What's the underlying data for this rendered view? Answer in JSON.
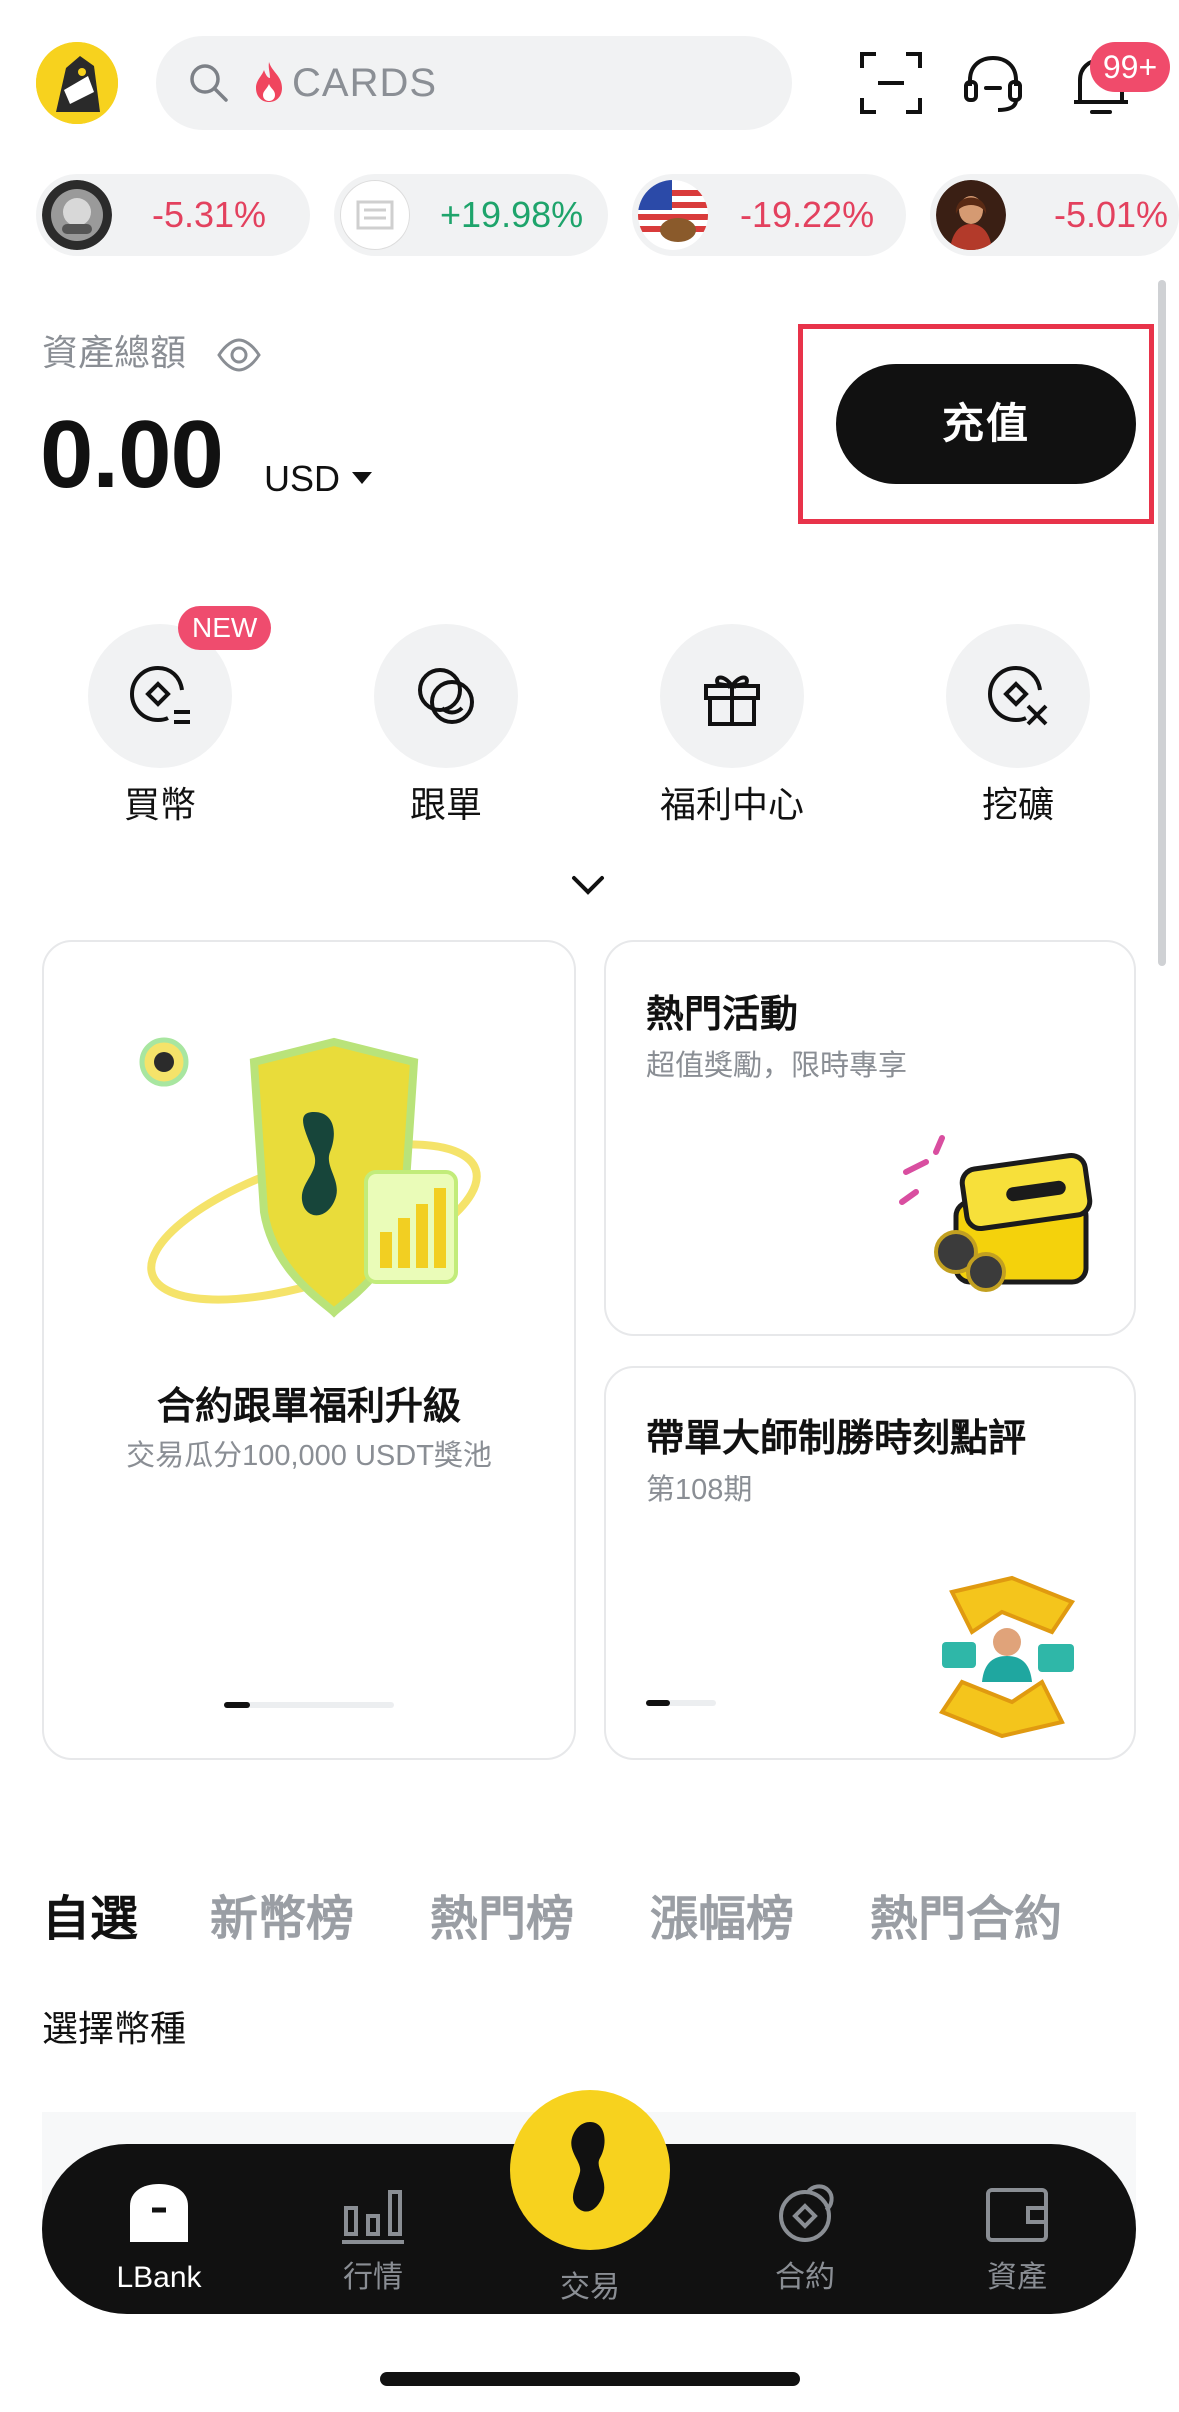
{
  "header": {
    "search_placeholder": "CARDS",
    "notification_badge": "99+"
  },
  "ticker": [
    {
      "change": "-5.31%",
      "direction": "down"
    },
    {
      "change": "+19.98%",
      "direction": "up"
    },
    {
      "change": "-19.22%",
      "direction": "down"
    },
    {
      "change": "-5.01%",
      "direction": "down"
    }
  ],
  "assets": {
    "label": "資產總額",
    "amount": "0.00",
    "currency": "USD",
    "deposit_label": "充值"
  },
  "quick_actions": [
    {
      "label": "買幣",
      "badge": "NEW",
      "icon": "buy-coin-icon"
    },
    {
      "label": "跟單",
      "icon": "copy-trade-icon"
    },
    {
      "label": "福利中心",
      "icon": "gift-icon"
    },
    {
      "label": "挖礦",
      "icon": "mining-icon"
    }
  ],
  "cards": {
    "main": {
      "title": "合約跟單福利升級",
      "subtitle": "交易瓜分100,000 USDT獎池"
    },
    "hot": {
      "title": "熱門活動",
      "subtitle": "超值獎勵，限時專享"
    },
    "master": {
      "title": "帶單大師制勝時刻點評",
      "subtitle": "第108期"
    }
  },
  "market_tabs": [
    {
      "label": "自選",
      "active": true
    },
    {
      "label": "新幣榜",
      "active": false
    },
    {
      "label": "熱門榜",
      "active": false
    },
    {
      "label": "漲幅榜",
      "active": false
    },
    {
      "label": "熱門合約",
      "active": false
    }
  ],
  "select_coin": "選擇幣種",
  "bottom_nav": [
    {
      "label": "LBank",
      "active": true,
      "icon": "home-icon"
    },
    {
      "label": "行情",
      "active": false,
      "icon": "market-chart-icon"
    },
    {
      "label": "交易",
      "active": false,
      "icon": "trade-icon"
    },
    {
      "label": "合約",
      "active": false,
      "icon": "contract-icon"
    },
    {
      "label": "資產",
      "active": false,
      "icon": "wallet-icon"
    }
  ],
  "colors": {
    "brand_yellow": "#f7d21e",
    "negative": "#e3415e",
    "positive": "#1ea46b",
    "highlight_red": "#e8334a"
  }
}
